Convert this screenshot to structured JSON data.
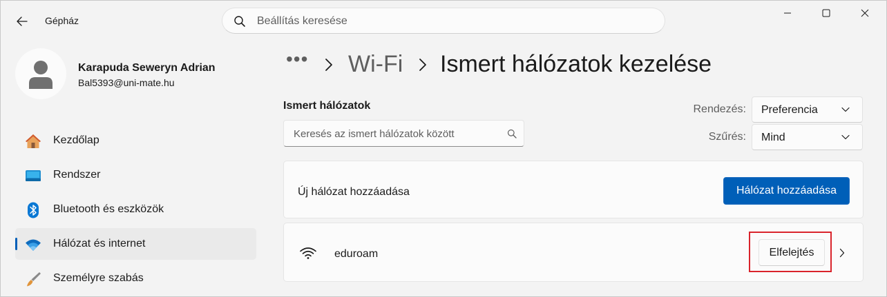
{
  "window": {
    "title": "Gépház",
    "controls": [
      "minimize",
      "maximize",
      "close"
    ]
  },
  "search": {
    "placeholder": "Beállítás keresése"
  },
  "profile": {
    "name": "Karapuda Seweryn Adrian",
    "email": "Bal5393@uni-mate.hu"
  },
  "sidebar": {
    "items": [
      {
        "label": "Kezdőlap",
        "icon": "home-icon",
        "active": false
      },
      {
        "label": "Rendszer",
        "icon": "system-icon",
        "active": false
      },
      {
        "label": "Bluetooth és eszközök",
        "icon": "bluetooth-icon",
        "active": false
      },
      {
        "label": "Hálózat és internet",
        "icon": "network-icon",
        "active": true
      },
      {
        "label": "Személyre szabás",
        "icon": "brush-icon",
        "active": false
      }
    ]
  },
  "breadcrumb": {
    "overflow": "•••",
    "parent": "Wi-Fi",
    "current": "Ismert hálózatok kezelése"
  },
  "known_networks": {
    "title": "Ismert hálózatok",
    "search_placeholder": "Keresés az ismert hálózatok között",
    "sort_label": "Rendezés:",
    "sort_value": "Preferencia",
    "filter_label": "Szűrés:",
    "filter_value": "Mind"
  },
  "add_network": {
    "label": "Új hálózat hozzáadása",
    "button": "Hálózat hozzáadása"
  },
  "networks": [
    {
      "name": "eduroam",
      "forget_label": "Elfelejtés"
    }
  ],
  "colors": {
    "accent": "#005fb8",
    "highlight": "#d9232b",
    "background": "#f3f3f3",
    "card": "#fbfbfb"
  }
}
